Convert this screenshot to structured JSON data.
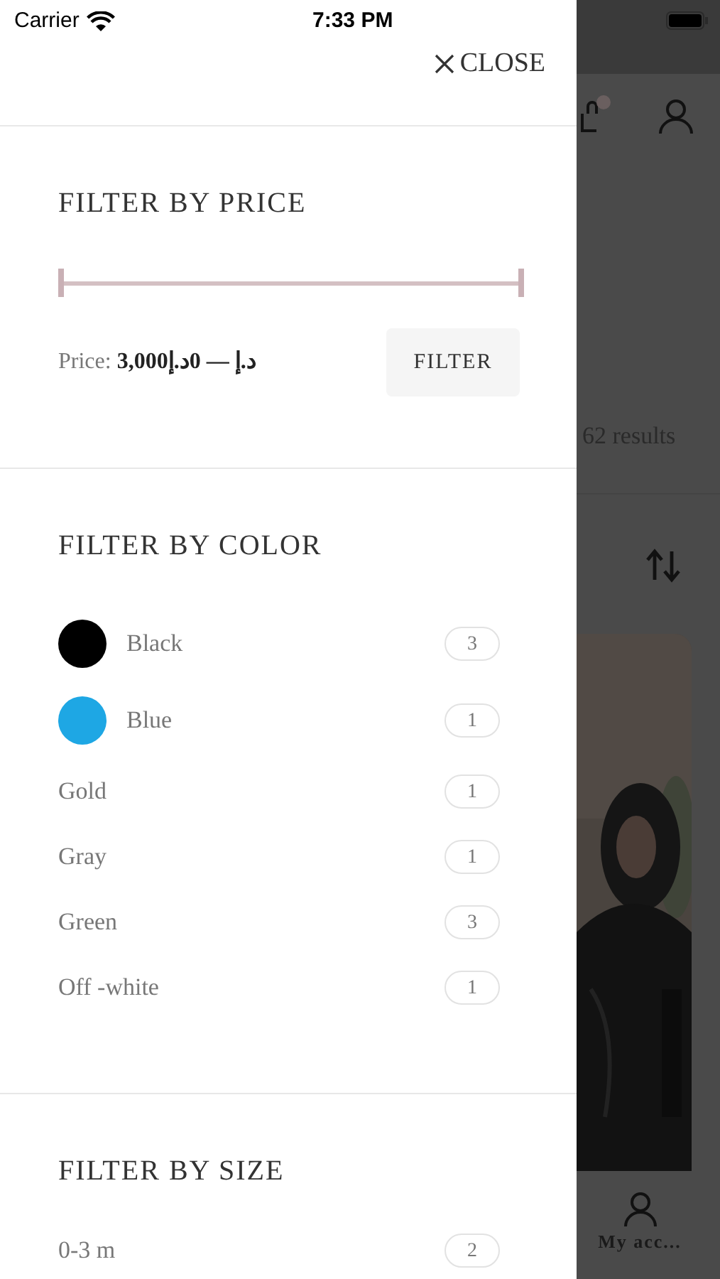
{
  "status_bar": {
    "carrier": "Carrier",
    "time": "7:33 PM"
  },
  "drawer": {
    "close_label": "CLOSE",
    "price": {
      "title": "FILTER BY PRICE",
      "slider": {
        "level": 1
      },
      "summary": "Price: **3,000د.إ — 0د.إ**",
      "button": "FILTER"
    },
    "color": {
      "title": "FILTER BY COLOR",
      "items": [
        {
          "kind": "swatch",
          "label": "Black",
          "color": "#000000",
          "count": "3"
        },
        {
          "kind": "swatch",
          "label": "Blue",
          "color": "#1ea7e4",
          "count": "1"
        },
        {
          "kind": "plain",
          "label": "Gold",
          "count": "1"
        },
        {
          "kind": "plain",
          "label": "Gray",
          "count": "1"
        },
        {
          "kind": "plain",
          "label": "Green",
          "count": "3"
        },
        {
          "kind": "plain",
          "label": "Off -white",
          "count": "1"
        }
      ]
    },
    "size": {
      "title": "FILTER BY SIZE",
      "items": [
        {
          "label": "0-3 m",
          "count": "2"
        }
      ]
    }
  },
  "background_page": {
    "results": "62 results",
    "tab_label": "My acc..."
  }
}
